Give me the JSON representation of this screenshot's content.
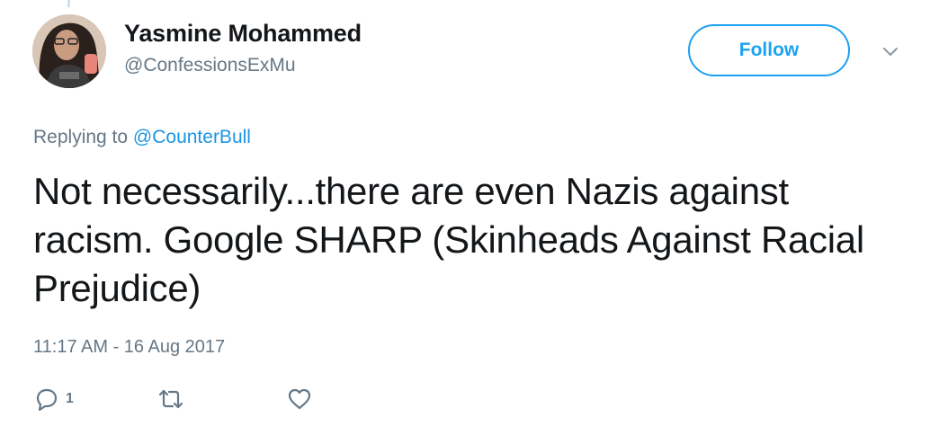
{
  "colors": {
    "accent": "#1da1f2",
    "link": "#1b95e0",
    "secondary_text": "#657786",
    "primary_text": "#14171a"
  },
  "author": {
    "display_name": "Yasmine Mohammed",
    "handle": "@ConfessionsExMu"
  },
  "header": {
    "follow_label": "Follow",
    "more_icon": "chevron-down-icon"
  },
  "reply_context": {
    "prefix": "Replying to",
    "mention": "@CounterBull"
  },
  "tweet": {
    "text": "Not necessarily...there are even Nazis against racism. Google SHARP (Skinheads Against Racial Prejudice)",
    "timestamp": "11:17 AM - 16 Aug 2017"
  },
  "actions": {
    "reply": {
      "icon": "reply-icon",
      "count": "1"
    },
    "retweet": {
      "icon": "retweet-icon"
    },
    "like": {
      "icon": "heart-icon"
    }
  }
}
